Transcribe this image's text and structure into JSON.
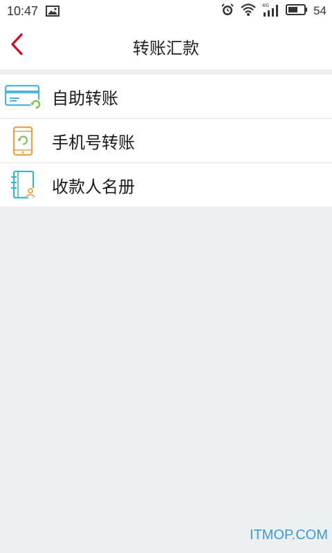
{
  "status_bar": {
    "time": "10:47",
    "network": "4G",
    "battery": "54",
    "icons": [
      "image-icon",
      "alarm-icon",
      "wifi-icon",
      "signal-icon",
      "battery-icon"
    ]
  },
  "header": {
    "title": "转账汇款",
    "back_icon": "chevron-left-icon",
    "accent_color": "#d0021b"
  },
  "menu": {
    "items": [
      {
        "label": "自助转账",
        "icon": "card-transfer-icon",
        "icon_color": "#4bb3e3"
      },
      {
        "label": "手机号转账",
        "icon": "phone-transfer-icon",
        "icon_color": "#e8a04a"
      },
      {
        "label": "收款人名册",
        "icon": "payee-book-icon",
        "icon_color": "#3bb7c9"
      }
    ]
  },
  "watermark": "ITMOP.COM"
}
